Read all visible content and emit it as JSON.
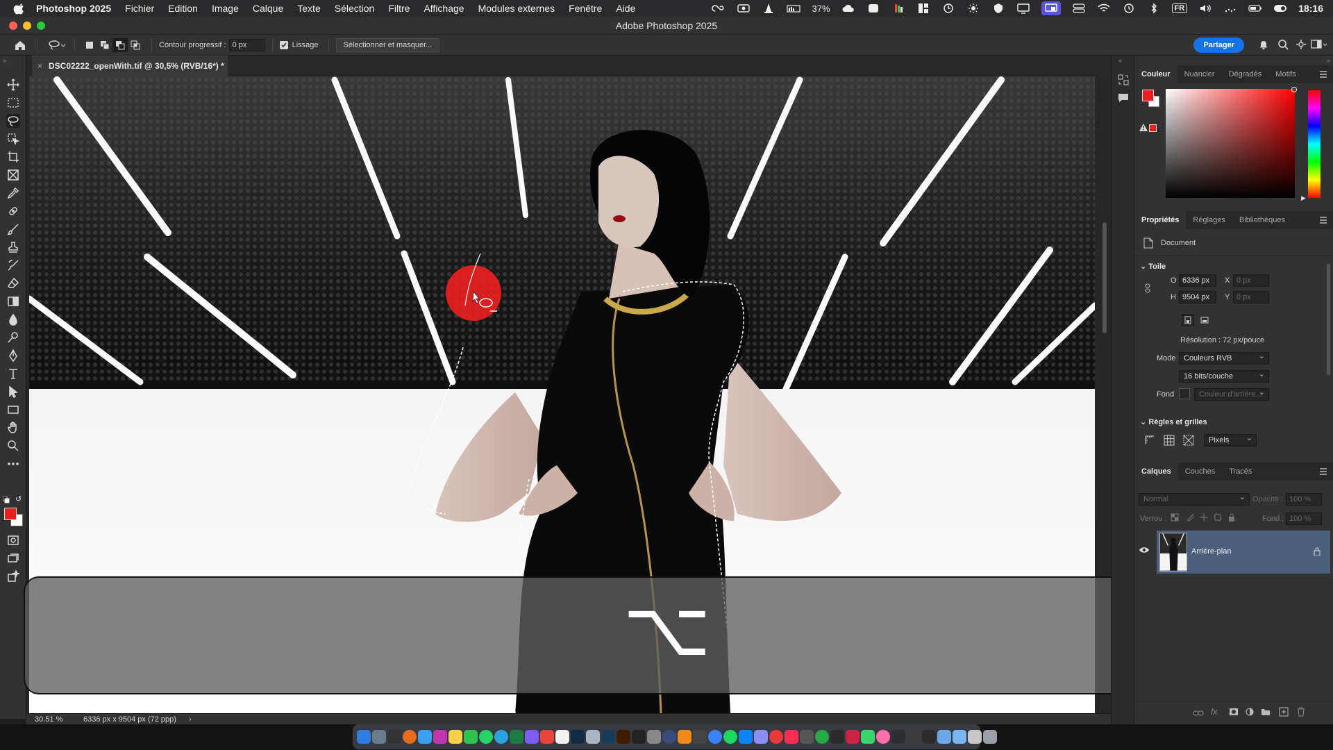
{
  "menubar": {
    "app_name": "Photoshop 2025",
    "items": [
      "Fichier",
      "Edition",
      "Image",
      "Calque",
      "Texte",
      "Sélection",
      "Filtre",
      "Affichage",
      "Modules externes",
      "Fenêtre",
      "Aide"
    ],
    "battery_percent": "37%",
    "input_source": "FR",
    "clock": "18:16"
  },
  "window": {
    "title": "Adobe Photoshop 2025"
  },
  "options": {
    "feather_label": "Contour progressif :",
    "feather_value": "0 px",
    "smoothing_label": "Lissage",
    "smoothing_checked": true,
    "select_mask_label": "Sélectionner et masquer...",
    "share_label": "Partager"
  },
  "document": {
    "tab_title": "DSC02222_openWith.tif @ 30,5% (RVB/16*) *",
    "zoom": "30.51 %",
    "dimensions": "6336 px x 9504 px (72 ppp)"
  },
  "overlay": {
    "key_symbol": "⌥"
  },
  "color_panel": {
    "tabs": [
      "Couleur",
      "Nuancier",
      "Dégradés",
      "Motifs"
    ],
    "active_tab": "Couleur",
    "foreground": "#e8201e",
    "background": "#ffffff"
  },
  "properties_panel": {
    "tabs": [
      "Propriétés",
      "Réglages",
      "Bibliothèques"
    ],
    "active_tab": "Propriétés",
    "object_label": "Document",
    "canvas_section": "Toile",
    "width_label": "O",
    "width_value": "6336 px",
    "height_label": "H",
    "height_value": "9504 px",
    "x_label": "X",
    "x_placeholder": "0 px",
    "y_label": "Y",
    "y_placeholder": "0 px",
    "resolution": "Résolution : 72 px/pouce",
    "mode_label": "Mode",
    "mode_value": "Couleurs RVB",
    "depth_value": "16 bits/couche",
    "fill_label": "Fond",
    "fill_value": "Couleur d'arrière...",
    "rulers_section": "Règles et grilles",
    "units_value": "Pixels"
  },
  "layers_panel": {
    "tabs": [
      "Calques",
      "Couches",
      "Tracés"
    ],
    "active_tab": "Calques",
    "blend_mode": "Normal",
    "opacity_label": "Opacité :",
    "opacity_value": "100 %",
    "lock_label": "Verrou :",
    "fill_label": "Fond :",
    "fill_value": "100 %",
    "layers": [
      {
        "name": "Arrière-plan",
        "visible": true,
        "locked": true
      }
    ]
  }
}
